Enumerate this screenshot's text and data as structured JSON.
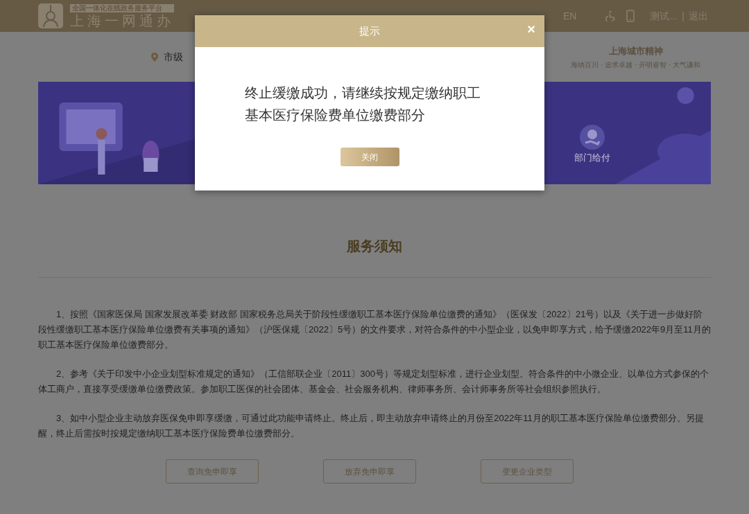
{
  "header": {
    "logo_tagline": "全国一体化在线政务服务平台",
    "logo_title": "上海一网通办",
    "language": "EN",
    "user": "测试...",
    "separator": "|",
    "logout": "退出"
  },
  "location": "市级",
  "city_spirit": {
    "title": "上海城市精神",
    "motto": "海纳百川 · 追求卓越 · 开明睿智 · 大气谦和"
  },
  "banner": {
    "kind": "picture",
    "service_label": "部门给付"
  },
  "notice": {
    "title": "服务须知",
    "paragraphs": [
      "1、按照《国家医保局 国家发展改革委 财政部 国家税务总局关于阶段性缓缴职工基本医疗保险单位缴费的通知》（医保发〔2022〕21号）以及《关于进一步做好阶段性缓缴职工基本医疗保险单位缴费有关事项的通知》（沪医保规〔2022〕5号）的文件要求，对符合条件的中小型企业，以免申即享方式，给予缓缴2022年9月至11月的职工基本医疗保险单位缴费部分。",
      "2、参考《关于印发中小企业划型标准规定的通知》（工信部联企业〔2011〕300号）等规定划型标准，进行企业划型。符合条件的中小微企业、以单位方式参保的个体工商户，直接享受缓缴单位缴费政策。参加职工医保的社会团体、基金会、社会服务机构、律师事务所、会计师事务所等社会组织参照执行。",
      "3、如中小型企业主动放弃医保免申即享缓缴，可通过此功能申请终止。终止后，即主动放弃申请终止的月份至2022年11月的职工基本医疗保险单位缴费部分。另提醒，终止后需按时按规定缴纳职工基本医疗保险费单位缴费部分。"
    ],
    "buttons": [
      "查询免申即享",
      "放弃免申即享",
      "变更企业类型"
    ]
  },
  "dialog": {
    "title": "提示",
    "close_icon": "×",
    "message": "终止缓缴成功，请继续按规定缴纳职工基本医疗保险费单位缴费部分",
    "button": "关闭"
  }
}
